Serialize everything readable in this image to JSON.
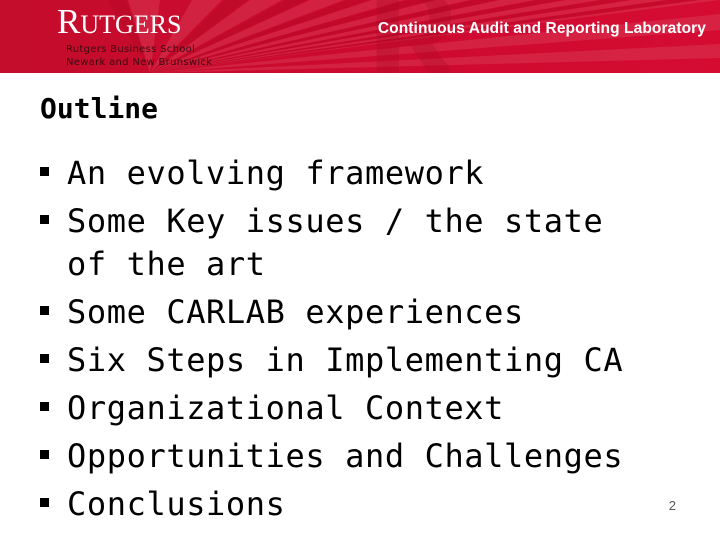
{
  "header": {
    "background_color": "#CC0A2F",
    "logo": {
      "wordmark_lead": "R",
      "wordmark_rest": "UTGERS",
      "subtitle_line1": "Rutgers Business School",
      "subtitle_line2": "Newark and New Brunswick"
    },
    "title": "Continuous Audit and Reporting Laboratory"
  },
  "slide": {
    "title": "Outline",
    "bullets": [
      {
        "text": "An evolving framework"
      },
      {
        "text": "Some Key issues / the state\nof the art"
      },
      {
        "text": "Some CARLAB experiences"
      },
      {
        "text": "Six Steps in Implementing CA"
      },
      {
        "text": "Organizational Context"
      },
      {
        "text": "Opportunities and Challenges"
      },
      {
        "text": "Conclusions"
      }
    ],
    "page_number": "2"
  }
}
